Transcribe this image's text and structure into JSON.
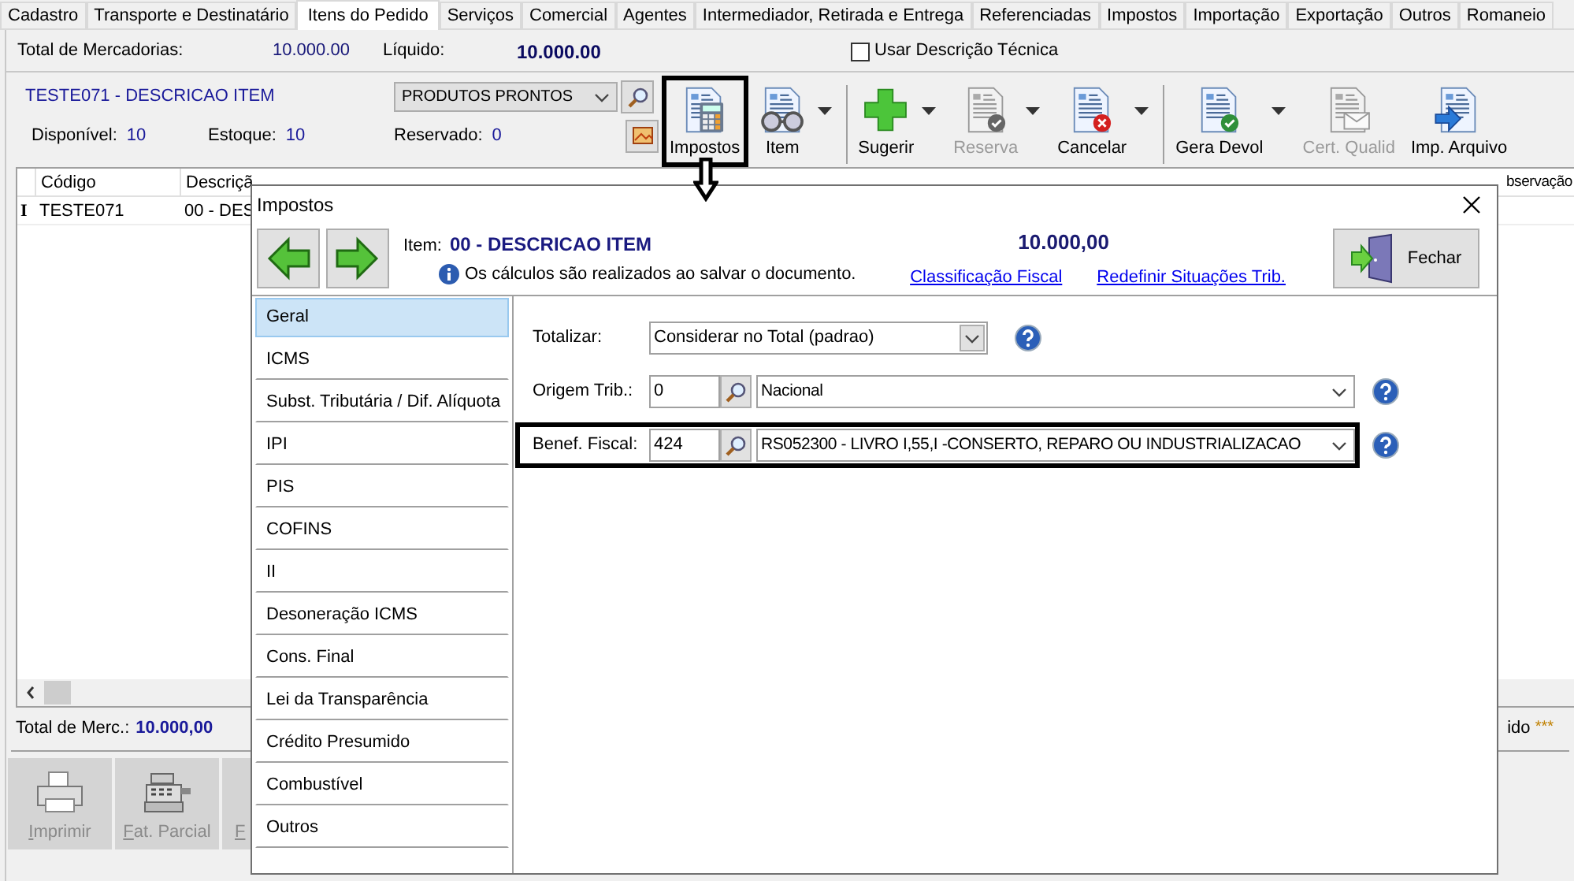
{
  "tabs": [
    {
      "label": "Cadastro",
      "selected": false
    },
    {
      "label": "Transporte e Destinatário",
      "selected": false
    },
    {
      "label": "Itens do Pedido",
      "selected": true
    },
    {
      "label": "Serviços",
      "selected": false
    },
    {
      "label": "Comercial",
      "selected": false
    },
    {
      "label": "Agentes",
      "selected": false
    },
    {
      "label": "Intermediador, Retirada e Entrega",
      "selected": false
    },
    {
      "label": "Referenciadas",
      "selected": false
    },
    {
      "label": "Impostos",
      "selected": false
    },
    {
      "label": "Importação",
      "selected": false
    },
    {
      "label": "Exportação",
      "selected": false
    },
    {
      "label": "Outros",
      "selected": false
    },
    {
      "label": "Romaneio",
      "selected": false
    }
  ],
  "summary": {
    "total_label": "Total de Mercadorias:",
    "total_value": "10.000.00",
    "liquido_label": "Líquido:",
    "liquido_value": "10.000.00",
    "tech_desc": {
      "label": "Usar Descrição Técnica",
      "checked": false
    }
  },
  "product": {
    "title": "TESTE071 - DESCRICAO ITEM",
    "group": "PRODUTOS PRONTOS",
    "stock": [
      {
        "label": "Disponível:",
        "value": "10"
      },
      {
        "label": "Estoque:",
        "value": "10"
      },
      {
        "label": "Reservado:",
        "value": "0"
      }
    ]
  },
  "toolbar": [
    {
      "label": "Impostos",
      "kind": "calc",
      "dropdown": false,
      "disabled": false,
      "highlighted": true,
      "separator_before": false
    },
    {
      "label": "Item",
      "kind": "glasses",
      "dropdown": true,
      "disabled": false,
      "highlighted": false,
      "separator_before": false
    },
    {
      "label": "Sugerir",
      "kind": "plus",
      "dropdown": true,
      "disabled": false,
      "highlighted": false,
      "separator_before": true
    },
    {
      "label": "Reserva",
      "kind": "check",
      "dropdown": true,
      "disabled": true,
      "highlighted": false,
      "separator_before": false
    },
    {
      "label": "Cancelar",
      "kind": "cancel",
      "dropdown": true,
      "disabled": false,
      "highlighted": false,
      "separator_before": false
    },
    {
      "label": "Gera Devol",
      "kind": "check",
      "dropdown": true,
      "disabled": false,
      "highlighted": false,
      "separator_before": true
    },
    {
      "label": "Cert. Qualid",
      "kind": "mail",
      "dropdown": false,
      "disabled": true,
      "highlighted": false,
      "separator_before": false
    },
    {
      "label": "Imp. Arquivo",
      "kind": "import",
      "dropdown": false,
      "disabled": false,
      "highlighted": false,
      "separator_before": false
    }
  ],
  "grid": {
    "columns": [
      "Código",
      "Descriçã"
    ],
    "right_column": "bservação",
    "rows": [
      {
        "marker": "I",
        "cells": [
          "TESTE071",
          "00 - DES"
        ]
      }
    ]
  },
  "footer": {
    "total_label": "Total de Merc.:",
    "total_value": "10.000,00",
    "status_text": "ido",
    "status_mark": "***"
  },
  "bottom_buttons": [
    {
      "label": "Imprimir",
      "kind": "printer"
    },
    {
      "label": "Fat. Parcial",
      "kind": "register"
    },
    {
      "label": "F",
      "kind": "partial"
    }
  ],
  "dialog": {
    "title": "Impostos",
    "item_label": "Item:",
    "item_value": "00 - DESCRICAO ITEM",
    "info": "Os cálculos são realizados ao salvar o documento.",
    "amount": "10.000,00",
    "links": [
      "Classificação Fiscal",
      "Redefinir Situações Trib."
    ],
    "close_label": "Fechar",
    "sections": [
      {
        "label": "Geral",
        "selected": true
      },
      {
        "label": "ICMS",
        "selected": false
      },
      {
        "label": "Subst. Tributária / Dif. Alíquota",
        "selected": false
      },
      {
        "label": "IPI",
        "selected": false
      },
      {
        "label": "PIS",
        "selected": false
      },
      {
        "label": "COFINS",
        "selected": false
      },
      {
        "label": "II",
        "selected": false
      },
      {
        "label": "Desoneração ICMS",
        "selected": false
      },
      {
        "label": "Cons. Final",
        "selected": false
      },
      {
        "label": "Lei da Transparência",
        "selected": false
      },
      {
        "label": "Crédito Presumido",
        "selected": false
      },
      {
        "label": "Combustível",
        "selected": false
      },
      {
        "label": "Outros",
        "selected": false
      }
    ],
    "fields": [
      {
        "label": "Totalizar:",
        "kind": "select",
        "value": "Considerar no Total (padrao)",
        "highlighted": false
      },
      {
        "label": "Origem Trib.:",
        "kind": "lookup",
        "code": "0",
        "value": "Nacional",
        "highlighted": false
      },
      {
        "label": "Benef. Fiscal:",
        "kind": "lookup",
        "code": "424",
        "value": "RS052300 - LIVRO I,55,I -CONSERTO, REPARO OU INDUSTRIALIZACAO",
        "highlighted": true
      }
    ]
  }
}
